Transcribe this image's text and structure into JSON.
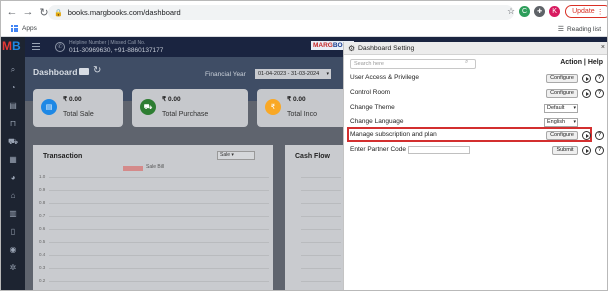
{
  "browser": {
    "url": "books.margbooks.com/dashboard",
    "bookmark_apps": "Apps",
    "reading_list": "Reading list",
    "update_label": "Update",
    "profile_initial": "K"
  },
  "app": {
    "logo_m": "M",
    "logo_b": "B",
    "helpline": "Helpline Number | Missed Call No.",
    "phones": "011-30969630, +91-8860137177",
    "brand_left": "MARG",
    "brand_right": "BOOK"
  },
  "dashboard": {
    "title": "Dashboard",
    "financial_year_label": "Financial Year",
    "financial_year_value": "01-04-2023 - 31-03-2024",
    "cards": [
      {
        "amount": "₹ 0.00",
        "label": "Total Sale",
        "color": "#1e88e5"
      },
      {
        "amount": "₹ 0.00",
        "label": "Total Purchase",
        "color": "#2e7d32"
      },
      {
        "amount": "₹ 0.00",
        "label": "Total Inco",
        "color": "#f9a825"
      }
    ],
    "transaction_title": "Transaction",
    "transaction_select": "Sale",
    "legend_label": "Sale Bill",
    "cashflow_title": "Cash Flow",
    "y_ticks": [
      "1.0",
      "0.9",
      "0.8",
      "0.7",
      "0.6",
      "0.5",
      "0.4",
      "0.3",
      "0.2"
    ]
  },
  "settings": {
    "title": "Dashboard Setting",
    "search_placeholder": "Search here",
    "action_help": "Action | Help",
    "rows": [
      {
        "label": "User Access & Privilege",
        "control": "Configure"
      },
      {
        "label": "Control Room",
        "control": "Configure"
      },
      {
        "label": "Change Theme",
        "control": "Default"
      },
      {
        "label": "Change Language",
        "control": "English"
      },
      {
        "label": "Manage subscription and plan",
        "control": "Configure"
      },
      {
        "label": "Enter Partner Code",
        "control": "Submit"
      }
    ],
    "help_glyph": "?",
    "close_glyph": "×"
  },
  "colors": {
    "highlight": "#d32f2f",
    "update_red": "#d93025"
  }
}
